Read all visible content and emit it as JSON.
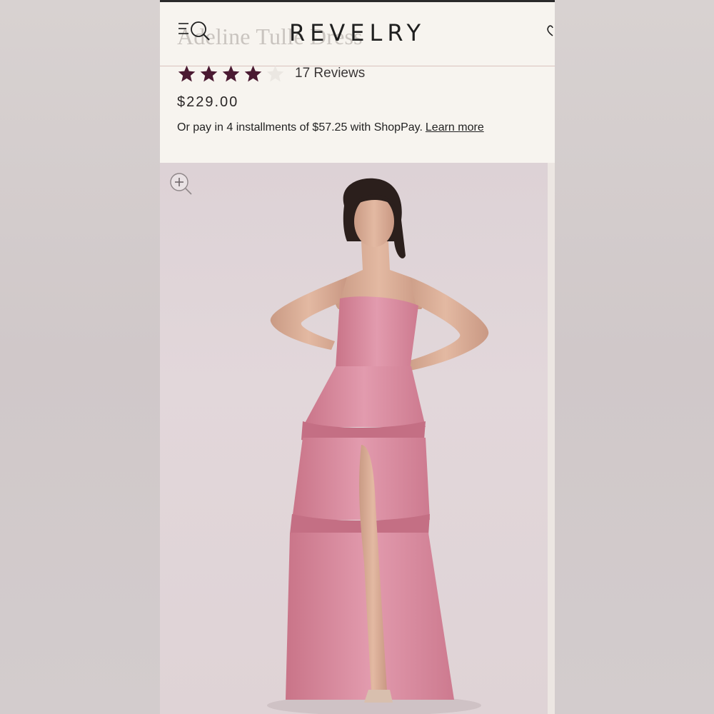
{
  "brand": "REVELRY",
  "product": {
    "title": "Adeline Tulle Dress",
    "rating": 4,
    "rating_max": 5,
    "review_count_label": "17 Reviews",
    "price": "$229.00",
    "installments_text": "Or pay in 4 installments of $57.25 with ShopPay.",
    "learn_more_label": "Learn more"
  },
  "icons": {
    "menu_search": "menu-search-icon",
    "wishlist": "heart-icon",
    "zoom": "zoom-in-icon"
  },
  "colors": {
    "star_filled": "#4a1a32",
    "star_empty": "#ebe7e2",
    "dress": "#d98a9e",
    "page_bg": "#f7f4ef"
  }
}
